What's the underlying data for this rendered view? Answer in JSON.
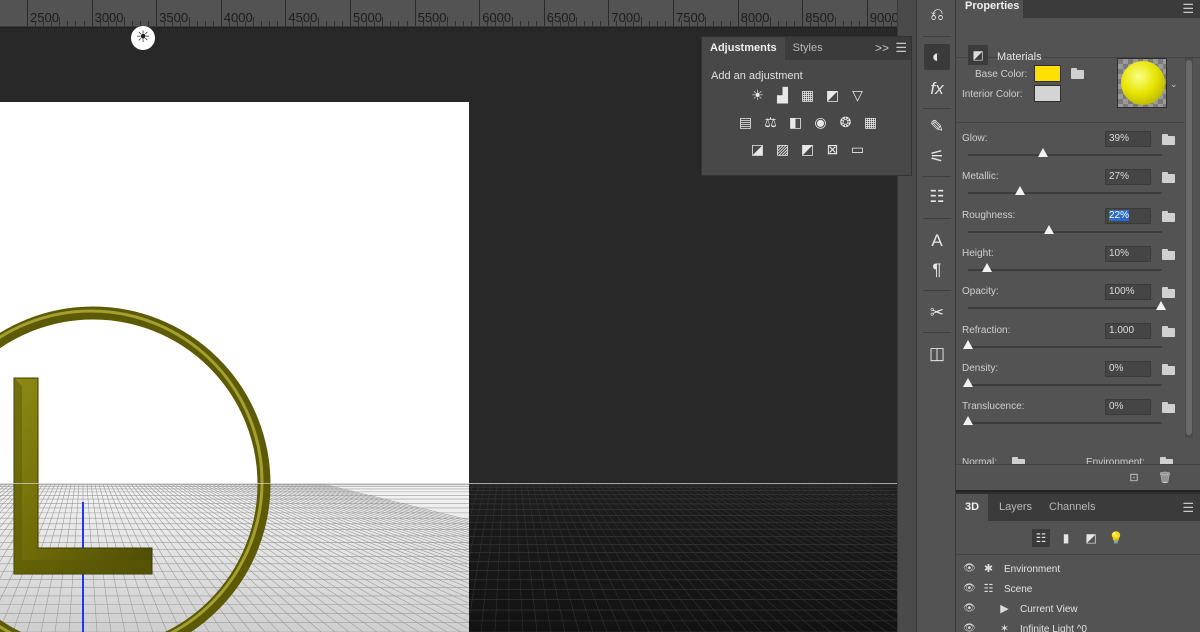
{
  "ruler": {
    "labels": [
      "2500",
      "3000",
      "3500",
      "4000",
      "4500",
      "5000",
      "5500",
      "6000",
      "6500",
      "7000",
      "7500",
      "8000",
      "8500",
      "9000"
    ]
  },
  "adjustments": {
    "tabs": [
      "Adjustments",
      "Styles"
    ],
    "expand_glyph": ">>",
    "title": "Add an adjustment",
    "rows": [
      [
        "brightness-contrast-icon",
        "levels-icon",
        "curves-icon",
        "exposure-icon",
        "vibrance-icon"
      ],
      [
        "hue-saturation-icon",
        "color-balance-icon",
        "black-white-icon",
        "photo-filter-icon",
        "channel-mixer-icon",
        "color-lookup-icon"
      ],
      [
        "invert-icon",
        "posterize-icon",
        "threshold-icon",
        "selective-color-icon",
        "gradient-map-icon"
      ]
    ]
  },
  "icon_bar": [
    "history-icon",
    "adjustments-icon",
    "styles-fx-icon",
    "brush-icon",
    "brush-settings-icon",
    "properties-3d-icon",
    "character-icon",
    "paragraph-icon",
    "tools-icon",
    "frame-icon"
  ],
  "properties": {
    "tab": "Properties",
    "section": "Materials",
    "base_color_label": "Base Color:",
    "base_color": "#ffe000",
    "interior_color_label": "Interior Color:",
    "interior_color": "#d4d4d4",
    "preview_color": "#e6e400",
    "sliders": [
      {
        "label": "Glow:",
        "value": "39%",
        "level": 0.39,
        "highlighted": false
      },
      {
        "label": "Metallic:",
        "value": "27%",
        "level": 0.27,
        "highlighted": false
      },
      {
        "label": "Roughness:",
        "value": "22%",
        "level": 0.42,
        "highlighted": true
      },
      {
        "label": "Height:",
        "value": "10%",
        "level": 0.1,
        "highlighted": false
      },
      {
        "label": "Opacity:",
        "value": "100%",
        "level": 1.0,
        "highlighted": false
      },
      {
        "label": "Refraction:",
        "value": "1.000",
        "level": 0.0,
        "highlighted": false
      },
      {
        "label": "Density:",
        "value": "0%",
        "level": 0.0,
        "highlighted": false
      },
      {
        "label": "Translucence:",
        "value": "0%",
        "level": 0.0,
        "highlighted": false
      }
    ],
    "normal_label": "Normal:",
    "environment_label": "Environment:"
  },
  "layers_panel": {
    "tabs": [
      "3D",
      "Layers",
      "Channels"
    ],
    "tools": [
      "whole-scene-icon",
      "meshes-icon",
      "materials-icon",
      "lights-icon"
    ],
    "rows": [
      {
        "name": "Environment",
        "icon": "environment-icon",
        "indent": 0
      },
      {
        "name": "Scene",
        "icon": "scene-icon",
        "indent": 0
      },
      {
        "name": "Current View",
        "icon": "camera-icon",
        "indent": 1
      },
      {
        "name": "Infinite Light ^0",
        "icon": "light-icon",
        "indent": 1
      }
    ]
  }
}
